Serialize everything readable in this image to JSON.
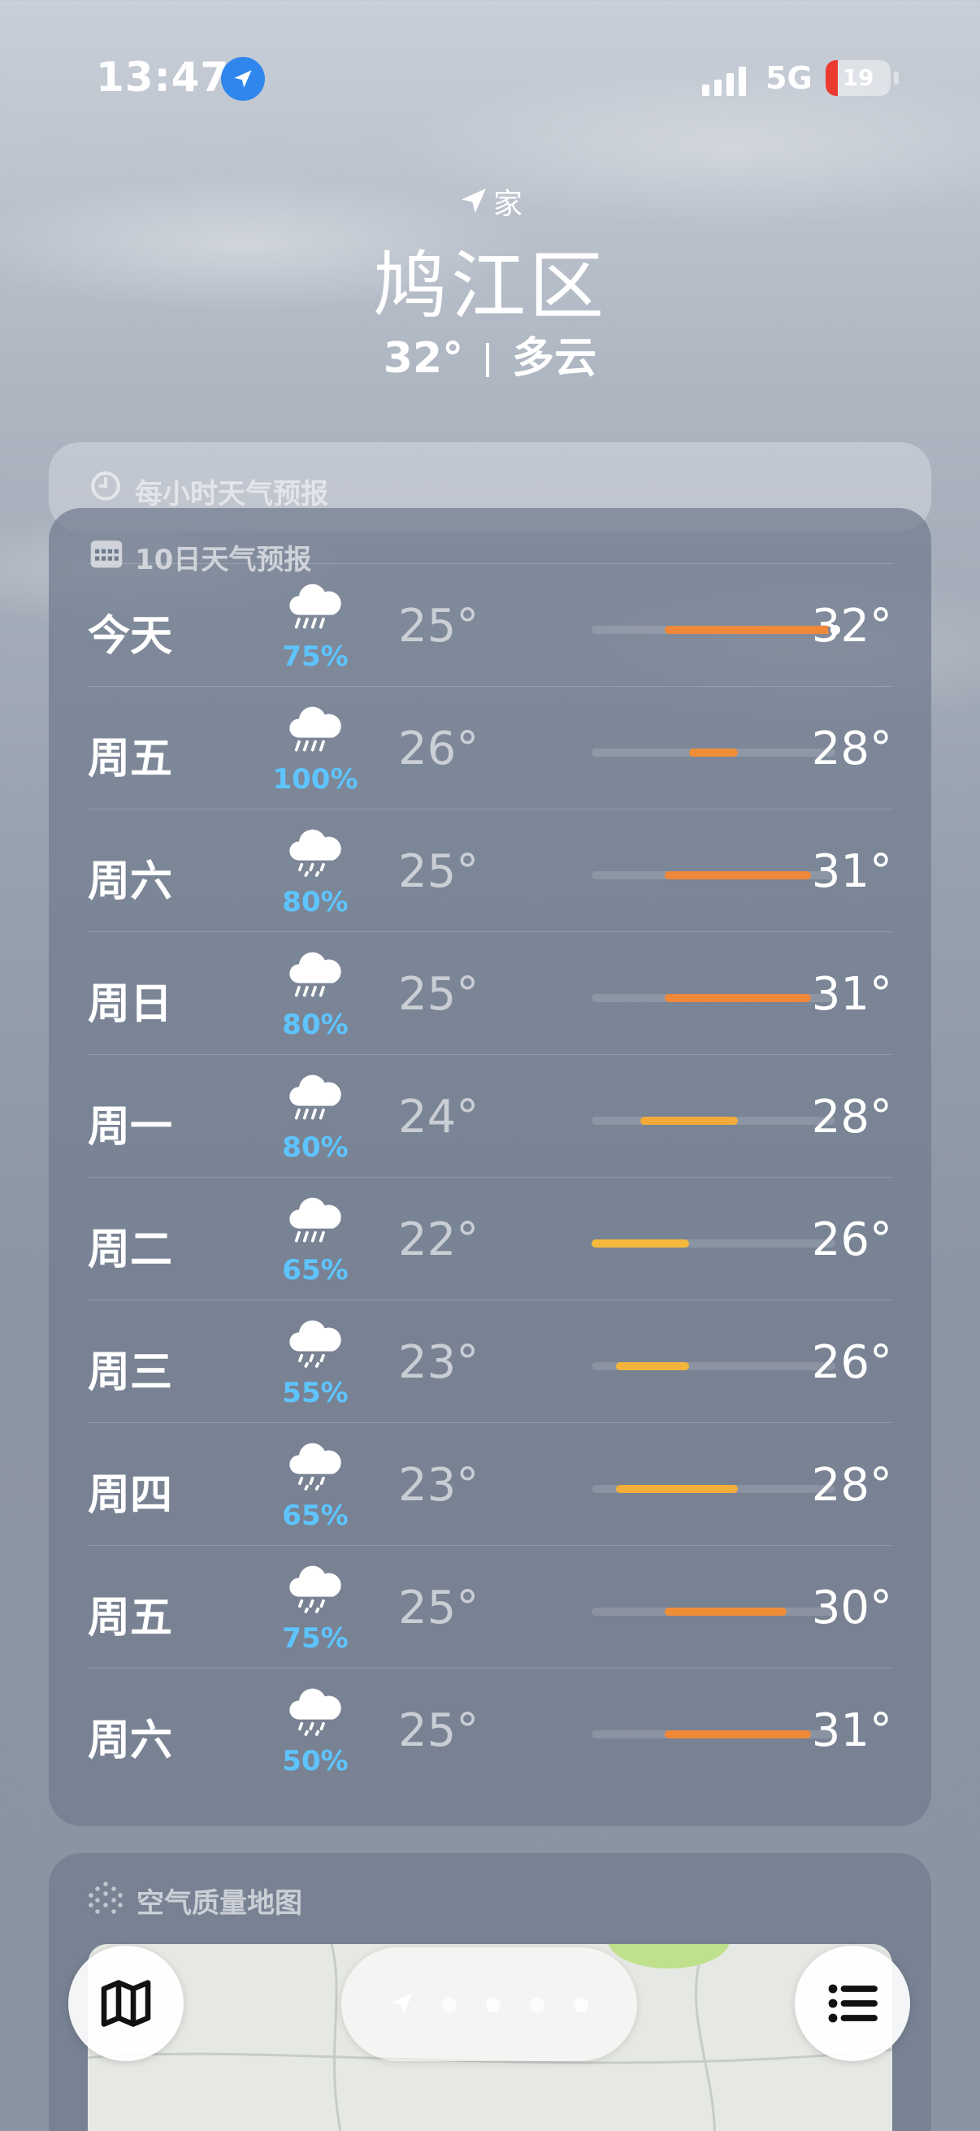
{
  "status_bar": {
    "time": "13:47",
    "network": "5G",
    "battery": "19",
    "battery_level": 0.19
  },
  "header": {
    "location_tag": "家",
    "city": "鸠江区",
    "temperature": "32°",
    "condition": "多云"
  },
  "hourly": {
    "label": "每小时天气预报",
    "icon": "clock-icon"
  },
  "daily": {
    "label": "10日天气预报",
    "icon": "calendar-icon",
    "scale_min": 22,
    "scale_max": 32,
    "days": [
      {
        "day": "今天",
        "icon": "cloud-rain-icon",
        "precip": "75%",
        "low": "25°",
        "high": "32°",
        "lo": 25,
        "hi": 32,
        "color": "#f0883a",
        "current": 32
      },
      {
        "day": "周五",
        "icon": "cloud-rain-icon",
        "precip": "100%",
        "low": "26°",
        "high": "28°",
        "lo": 26,
        "hi": 28,
        "color": "#f08e38"
      },
      {
        "day": "周六",
        "icon": "cloud-drizzle-icon",
        "precip": "80%",
        "low": "25°",
        "high": "31°",
        "lo": 25,
        "hi": 31,
        "color": "#f0883a"
      },
      {
        "day": "周日",
        "icon": "cloud-rain-icon",
        "precip": "80%",
        "low": "25°",
        "high": "31°",
        "lo": 25,
        "hi": 31,
        "color": "#f0883a"
      },
      {
        "day": "周一",
        "icon": "cloud-rain-icon",
        "precip": "80%",
        "low": "24°",
        "high": "28°",
        "lo": 24,
        "hi": 28,
        "color": "#f2ab3a"
      },
      {
        "day": "周二",
        "icon": "cloud-rain-icon",
        "precip": "65%",
        "low": "22°",
        "high": "26°",
        "lo": 22,
        "hi": 26,
        "color": "#f3b83c"
      },
      {
        "day": "周三",
        "icon": "cloud-drizzle-icon",
        "precip": "55%",
        "low": "23°",
        "high": "26°",
        "lo": 23,
        "hi": 26,
        "color": "#f3b43c"
      },
      {
        "day": "周四",
        "icon": "cloud-drizzle-icon",
        "precip": "65%",
        "low": "23°",
        "high": "28°",
        "lo": 23,
        "hi": 28,
        "color": "#f2ad3a"
      },
      {
        "day": "周五",
        "icon": "cloud-drizzle-icon",
        "precip": "75%",
        "low": "25°",
        "high": "30°",
        "lo": 25,
        "hi": 30,
        "color": "#f08e38"
      },
      {
        "day": "周六",
        "icon": "cloud-drizzle-icon",
        "precip": "50%",
        "low": "25°",
        "high": "31°",
        "lo": 25,
        "hi": 31,
        "color": "#f0883a"
      }
    ]
  },
  "air_quality": {
    "label": "空气质量地图",
    "icon": "dots-grid-icon"
  },
  "bottom_bar": {
    "map_icon": "map-icon",
    "list_icon": "list-icon",
    "location_icon": "location-arrow-icon",
    "page_count": 4
  }
}
